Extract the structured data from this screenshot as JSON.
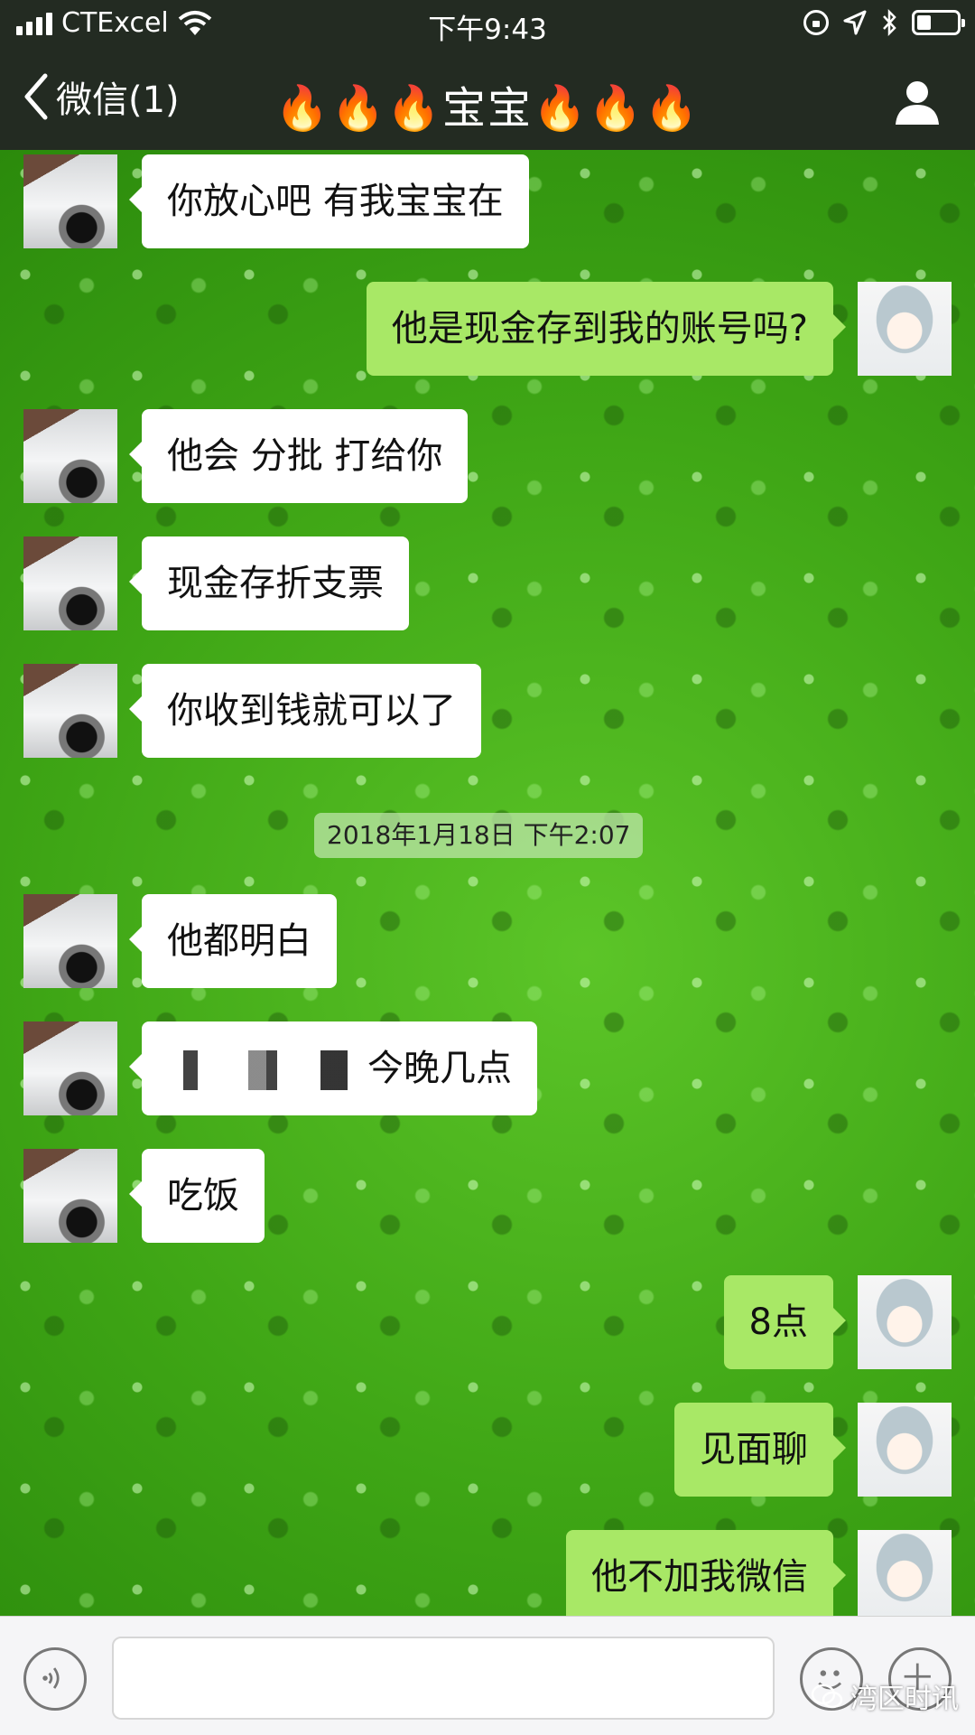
{
  "status_bar": {
    "carrier": "CTExcel",
    "time": "下午9:43",
    "signal_bars": 4,
    "battery_level": 0.35,
    "icons": [
      "signal-icon",
      "wifi-icon",
      "rotation-lock-icon",
      "location-icon",
      "bluetooth-icon",
      "battery-icon"
    ]
  },
  "nav": {
    "back_label": "微信(1)",
    "title": "🔥🔥🔥宝宝🔥🔥🔥",
    "icons": [
      "back-chevron-icon",
      "profile-icon"
    ]
  },
  "messages": [
    {
      "side": "in",
      "text": "你放心吧 有我宝宝在"
    },
    {
      "side": "out",
      "text": "他是现金存到我的账号吗?"
    },
    {
      "side": "in",
      "text": "他会 分批 打给你"
    },
    {
      "side": "in",
      "text": "现金存折支票"
    },
    {
      "side": "in",
      "text": "你收到钱就可以了"
    },
    {
      "side": "in",
      "text": "他都明白"
    },
    {
      "side": "in",
      "text": "今晚几点",
      "redacted_prefix": true
    },
    {
      "side": "in",
      "text": "吃饭"
    },
    {
      "side": "out",
      "text": "8点"
    },
    {
      "side": "out",
      "text": "见面聊"
    },
    {
      "side": "out",
      "text": "他不加我微信"
    }
  ],
  "timestamp": "2018年1月18日 下午2:07",
  "input_bar": {
    "placeholder": "",
    "value": "",
    "icons": [
      "voice-icon",
      "emoji-icon",
      "plus-icon"
    ]
  },
  "watermark": "湾区时讯",
  "colors": {
    "bar_background": "#232b22",
    "incoming_bubble": "#ffffff",
    "outgoing_bubble": "#a8e866",
    "wallpaper_green": "#3ea515"
  }
}
